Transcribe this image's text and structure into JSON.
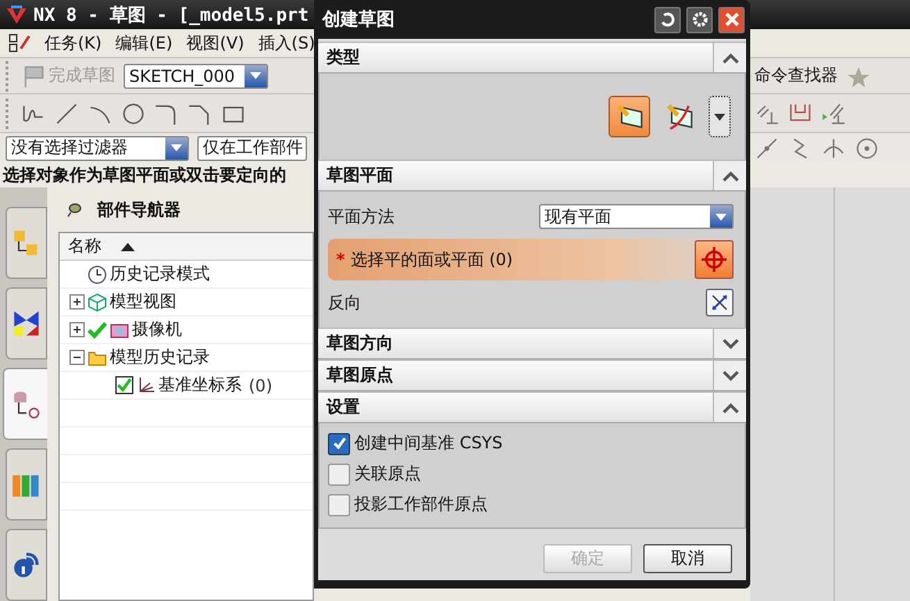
{
  "app": {
    "title": "NX 8 - 草图 - [_model5.prt",
    "menu": [
      "任务(K)",
      "编辑(E)",
      "视图(V)",
      "插入(S)"
    ],
    "finish_sketch": {
      "label": "完成草图",
      "disabled": true
    },
    "sketch_name": "SKETCH_000",
    "command_finder": "命令查找器",
    "selection_filter": "没有选择过滤器",
    "scope_filter": "仅在工作部件",
    "status": "选择对象作为草图平面或双击要定向的"
  },
  "navigator": {
    "title": "部件导航器",
    "column": "名称",
    "tabs": [
      {
        "kind": "assembly",
        "selected": false
      },
      {
        "kind": "constraints",
        "selected": false
      },
      {
        "kind": "part",
        "selected": true
      },
      {
        "kind": "library",
        "selected": false
      },
      {
        "kind": "info",
        "selected": false
      }
    ],
    "tree": [
      {
        "label": "历史记录模式",
        "kind": "clock"
      },
      {
        "label": "模型视图",
        "kind": "view",
        "expanded": false
      },
      {
        "label": "摄像机",
        "kind": "camera",
        "expanded": false,
        "checked": true
      },
      {
        "label": "模型历史记录",
        "kind": "folder",
        "expanded": true,
        "children": [
          {
            "label": "基准坐标系",
            "count": "(0)",
            "kind": "csys",
            "checked": true
          }
        ]
      }
    ]
  },
  "dialog": {
    "title": "创建草图",
    "sections": [
      {
        "kind": "type",
        "title": "类型",
        "expanded": true,
        "types": [
          {
            "selected": true
          },
          {
            "selected": false
          }
        ]
      },
      {
        "kind": "plane",
        "title": "草图平面",
        "expanded": true,
        "method_label": "平面方法",
        "method": "现有平面",
        "required_mark": "*",
        "selection": "选择平的面或平面 (0)",
        "reverse_label": "反向"
      },
      {
        "title": "草图方向",
        "expanded": false
      },
      {
        "title": "草图原点",
        "expanded": false
      },
      {
        "kind": "settings",
        "title": "设置",
        "expanded": true,
        "options": [
          {
            "label": "创建中间基准 CSYS",
            "checked": true
          },
          {
            "label": "关联原点",
            "checked": false
          },
          {
            "label": "投影工作部件原点",
            "checked": false
          }
        ]
      }
    ],
    "buttons": [
      {
        "label": "确定",
        "disabled": true
      },
      {
        "label": "取消",
        "disabled": false
      }
    ]
  }
}
